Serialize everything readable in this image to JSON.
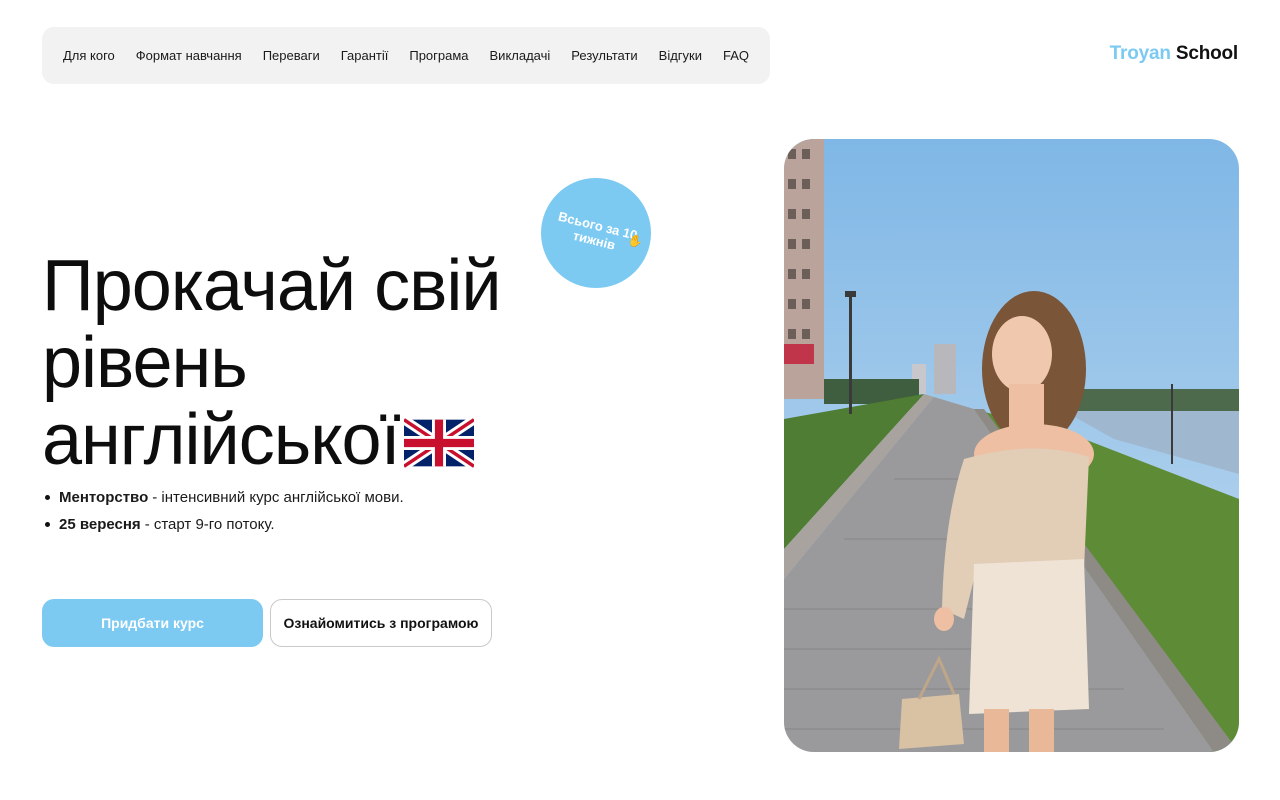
{
  "nav": {
    "items": [
      "Для кого",
      "Формат навчання",
      "Переваги",
      "Гарантії",
      "Програма",
      "Викладачі",
      "Результати",
      "Відгуки",
      "FAQ"
    ]
  },
  "logo": {
    "part1": "Troyan",
    "part2": "School"
  },
  "hero": {
    "title_line1": "Прокачай свій",
    "title_line2": "рівень",
    "title_line3": "англійської",
    "flag_icon": "uk-flag-icon"
  },
  "badge": {
    "line1": "Всього за 10",
    "line2": "тижнів",
    "icon": "waving-hand-icon"
  },
  "bullets": [
    {
      "bold": "Менторство",
      "text": "- інтенсивний курс англійської мови."
    },
    {
      "bold": "25 вересня",
      "text": "- старт 9-го потоку."
    }
  ],
  "buttons": {
    "primary": "Придбати курс",
    "secondary": "Ознайомитись з програмою"
  },
  "colors": {
    "accent": "#7ccaf2",
    "nav_bg": "#f2f2f2",
    "text": "#111111"
  }
}
